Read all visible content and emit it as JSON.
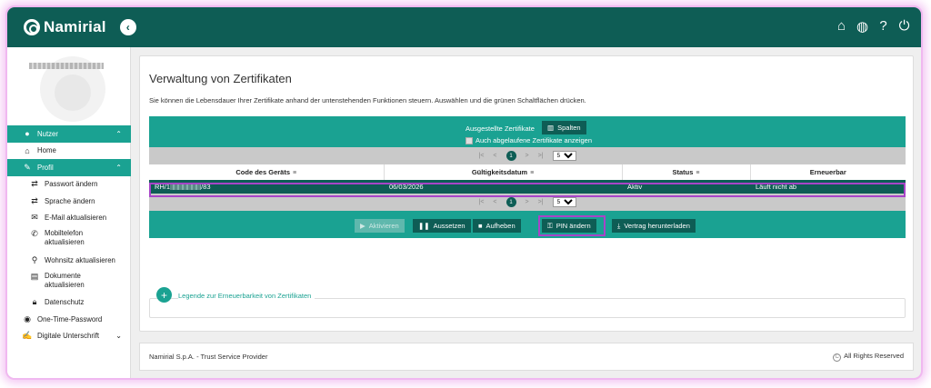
{
  "header": {
    "brand": "Namirial"
  },
  "sidebar": {
    "items": [
      {
        "label": "Nutzer"
      },
      {
        "label": "Home"
      },
      {
        "label": "Profil"
      },
      {
        "label": "Passwort ändern"
      },
      {
        "label": "Sprache ändern"
      },
      {
        "label": "E-Mail aktualisieren"
      },
      {
        "label": "Mobiltelefon aktualisieren"
      },
      {
        "label": "Wohnsitz aktualisieren"
      },
      {
        "label": "Dokumente aktualisieren"
      },
      {
        "label": "Datenschutz"
      },
      {
        "label": "One-Time-Password"
      },
      {
        "label": "Digitale Unterschrift"
      }
    ]
  },
  "main": {
    "title": "Verwaltung von Zertifikaten",
    "subtitle": "Sie können die Lebensdauer Ihrer Zertifikate anhand der untenstehenden Funktionen steuern. Auswählen und die grünen Schaltflächen drücken.",
    "issued_label": "Ausgestellte Zertifikate",
    "columns_button": "Spalten",
    "show_expired_label": "Auch abgelaufene Zertifikate anzeigen",
    "pager": {
      "first": "|<",
      "prev": "<",
      "current": "1",
      "next": ">",
      "last": ">|",
      "page_size": "5"
    },
    "table": {
      "headers": [
        "Code des Geräts",
        "Gültigkeitsdatum",
        "Status",
        "Erneuerbar"
      ],
      "rows": [
        {
          "code_prefix": "RH/1",
          "code_suffix": "/83",
          "validity": "06/03/2026",
          "status": "Aktiv",
          "renewable": "Läuft nicht ab"
        }
      ]
    },
    "actions": {
      "activate": "Aktivieren",
      "suspend": "Aussetzen",
      "revoke": "Aufheben",
      "change_pin": "PIN ändern",
      "download_contract": "Vertrag herunterladen"
    },
    "legend_link": "Legende zur Erneuerbarkeit von Zertifikaten"
  },
  "footer": {
    "company": "Namirial S.p.A. - Trust Service Provider",
    "rights": "All Rights Reserved"
  },
  "colors": {
    "primary_dark": "#0e5d55",
    "primary": "#1aa292",
    "highlight": "#a844c8"
  }
}
